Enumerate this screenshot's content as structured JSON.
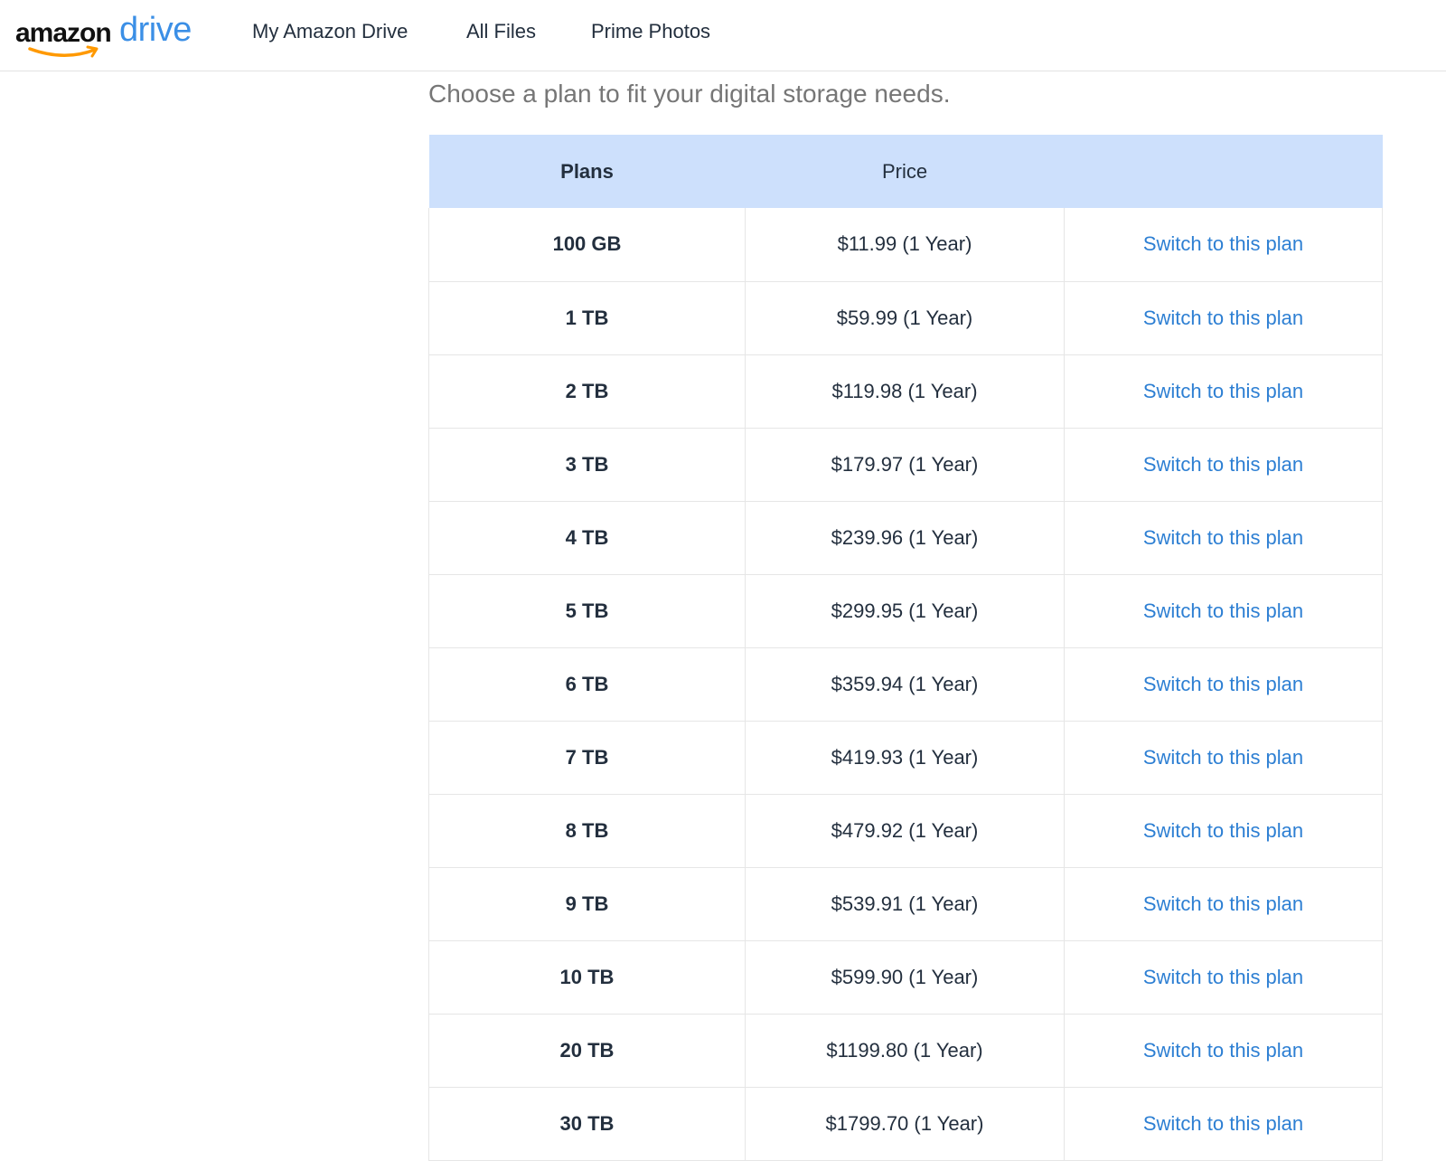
{
  "header": {
    "logo": {
      "word1": "amazon",
      "word2": "drive"
    },
    "nav": [
      {
        "label": "My Amazon Drive"
      },
      {
        "label": "All Files"
      },
      {
        "label": "Prime Photos"
      }
    ]
  },
  "main": {
    "intro": "Choose a plan to fit your digital storage needs.",
    "table": {
      "headers": {
        "plan": "Plans",
        "price": "Price",
        "action": ""
      },
      "rows": [
        {
          "plan": "100 GB",
          "price": "$11.99 (1 Year)",
          "action": "Switch to this plan"
        },
        {
          "plan": "1 TB",
          "price": "$59.99 (1 Year)",
          "action": "Switch to this plan"
        },
        {
          "plan": "2 TB",
          "price": "$119.98 (1 Year)",
          "action": "Switch to this plan"
        },
        {
          "plan": "3 TB",
          "price": "$179.97 (1 Year)",
          "action": "Switch to this plan"
        },
        {
          "plan": "4 TB",
          "price": "$239.96 (1 Year)",
          "action": "Switch to this plan"
        },
        {
          "plan": "5 TB",
          "price": "$299.95 (1 Year)",
          "action": "Switch to this plan"
        },
        {
          "plan": "6 TB",
          "price": "$359.94 (1 Year)",
          "action": "Switch to this plan"
        },
        {
          "plan": "7 TB",
          "price": "$419.93 (1 Year)",
          "action": "Switch to this plan"
        },
        {
          "plan": "8 TB",
          "price": "$479.92 (1 Year)",
          "action": "Switch to this plan"
        },
        {
          "plan": "9 TB",
          "price": "$539.91 (1 Year)",
          "action": "Switch to this plan"
        },
        {
          "plan": "10 TB",
          "price": "$599.90 (1 Year)",
          "action": "Switch to this plan"
        },
        {
          "plan": "20 TB",
          "price": "$1199.80 (1 Year)",
          "action": "Switch to this plan"
        },
        {
          "plan": "30 TB",
          "price": "$1799.70 (1 Year)",
          "action": "Switch to this plan"
        }
      ]
    }
  },
  "colors": {
    "brand_blue": "#3b8fe6",
    "brand_orange": "#ff9900",
    "link": "#2d7fd3",
    "table_header_bg": "#cde0fc"
  }
}
